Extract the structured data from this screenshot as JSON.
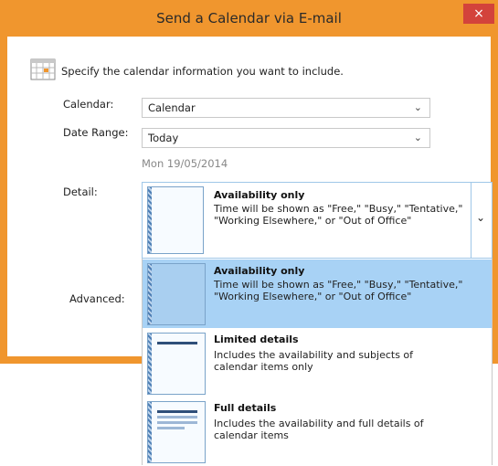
{
  "window": {
    "title": "Send a Calendar via E-mail",
    "close_symbol": "×",
    "accent_color": "#f0962e"
  },
  "form": {
    "instruction": "Specify the calendar information you want to include.",
    "calendar_label": "Calendar:",
    "calendar_value": "Calendar",
    "date_range_label": "Date Range:",
    "date_range_value": "Today",
    "date_text": "Mon 19/05/2014",
    "detail_label": "Detail:",
    "advanced_label": "Advanced:"
  },
  "detail_selected": {
    "title": "Availability only",
    "desc_line1": "Time will be shown as \"Free,\" \"Busy,\" \"Tentative,\"",
    "desc_line2": "\"Working Elsewhere,\" or \"Out of Office\""
  },
  "dropdown": {
    "items": [
      {
        "title": "Availability only",
        "desc_line1": "Time will be shown as \"Free,\" \"Busy,\" \"Tentative,\"",
        "desc_line2": "\"Working Elsewhere,\" or \"Out of Office\"",
        "selected": true
      },
      {
        "title": "Limited details",
        "desc_line1": "Includes the availability and subjects of",
        "desc_line2": "calendar items only",
        "selected": false
      },
      {
        "title": "Full details",
        "desc_line1": "Includes the availability and full details of",
        "desc_line2": "calendar items",
        "selected": false
      }
    ]
  },
  "icons": {
    "calendar": "calendar-icon",
    "combo_arrow": "chevron-down-icon",
    "combo_arrow_glyph": "⌄",
    "detail_arrow_glyph": "⌄"
  }
}
